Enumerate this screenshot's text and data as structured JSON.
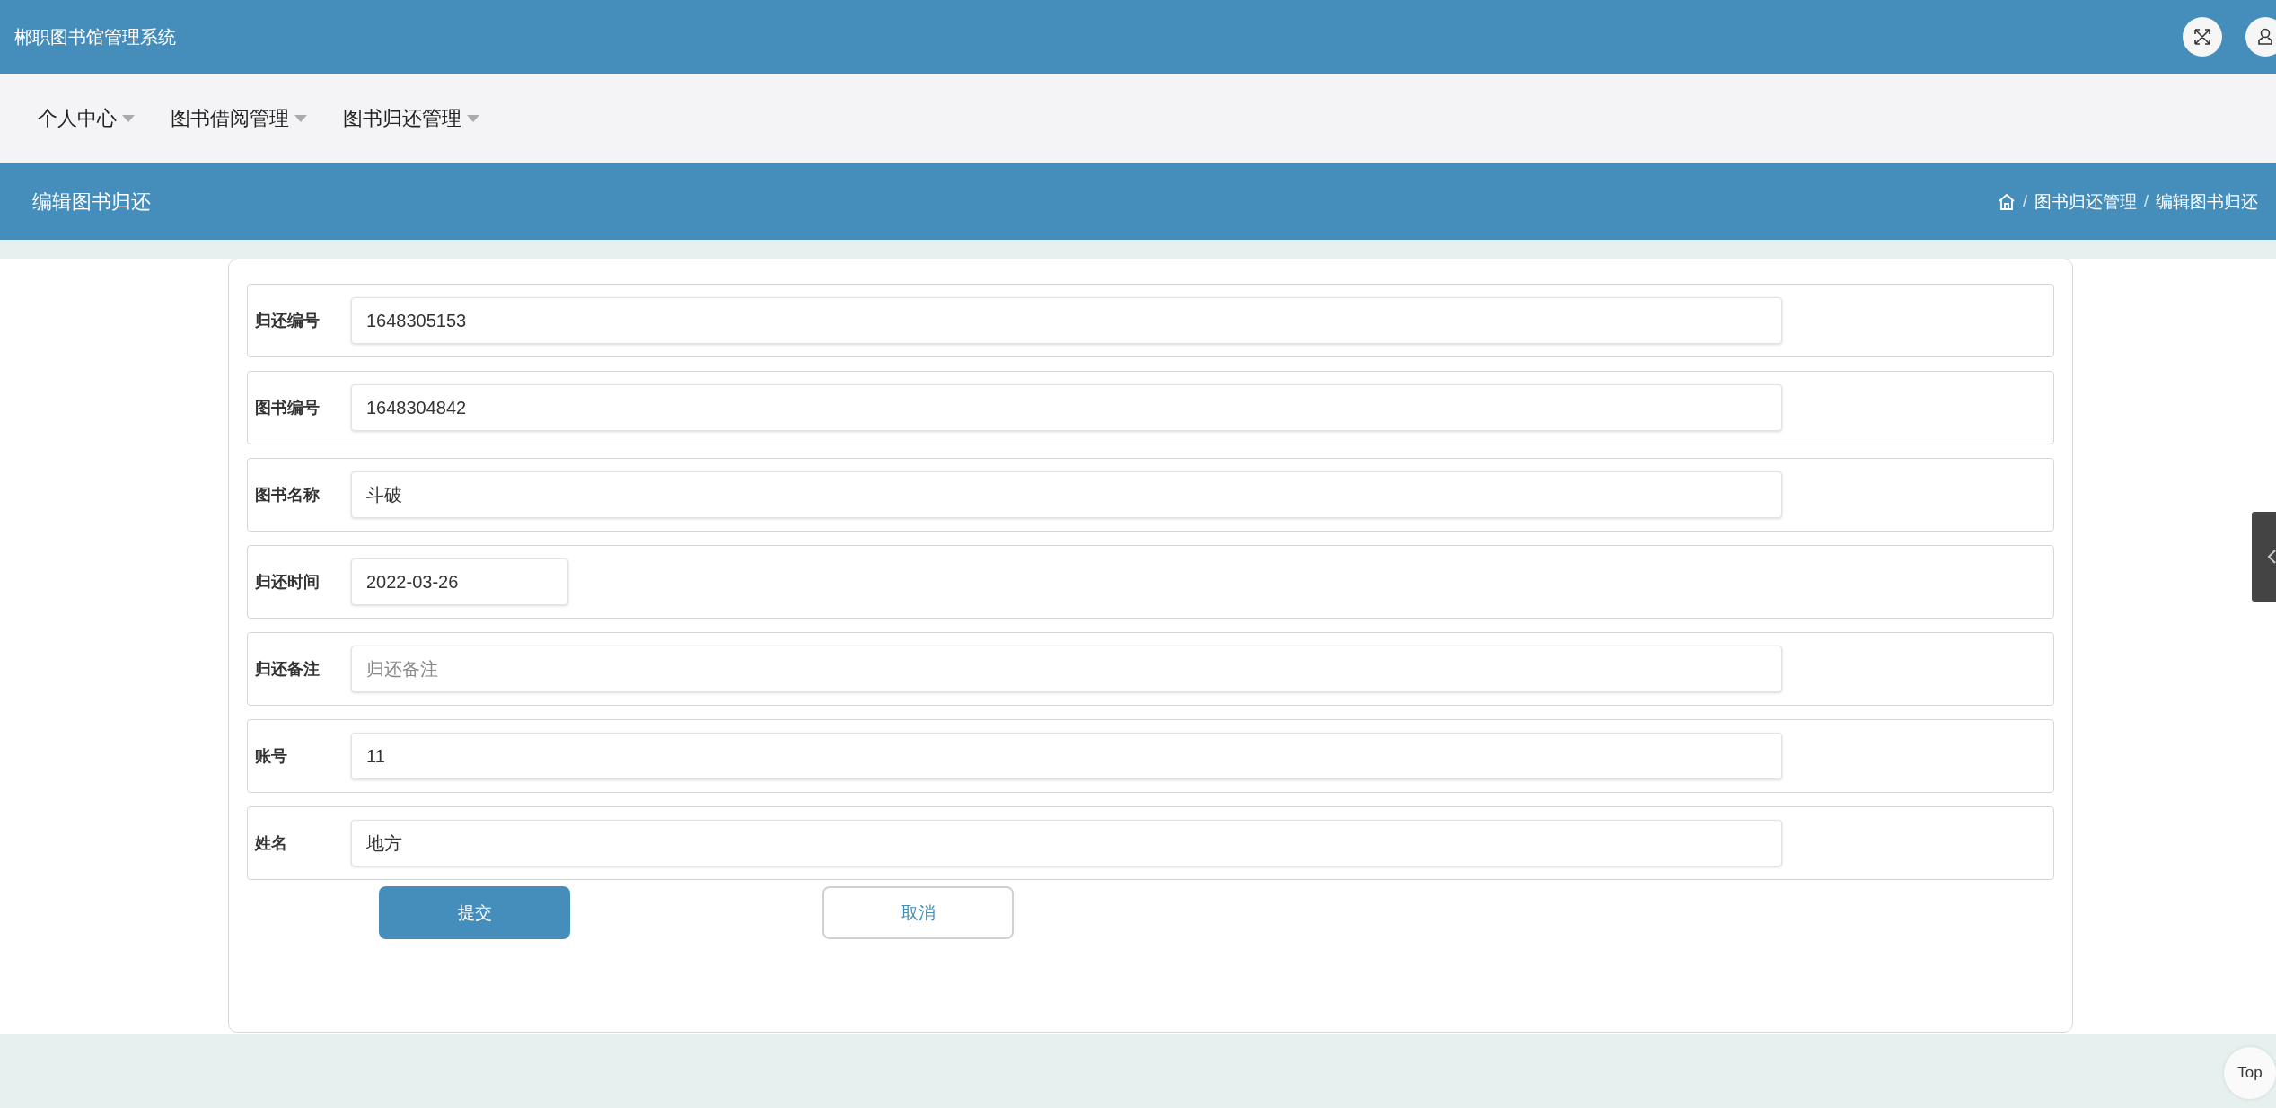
{
  "header": {
    "title": "郴职图书馆管理系统"
  },
  "nav": [
    {
      "label": "个人中心"
    },
    {
      "label": "图书借阅管理"
    },
    {
      "label": "图书归还管理"
    }
  ],
  "page_title": "编辑图书归还",
  "breadcrumb": [
    {
      "kind": "separator",
      "text": "/"
    },
    {
      "kind": "link",
      "text": "图书归还管理"
    },
    {
      "kind": "separator",
      "text": "/"
    },
    {
      "kind": "link",
      "text": "编辑图书归还"
    }
  ],
  "fields": [
    {
      "label": "归还编号",
      "kind": "text",
      "value": "1648305153"
    },
    {
      "label": "图书编号",
      "kind": "text",
      "value": "1648304842"
    },
    {
      "label": "图书名称",
      "kind": "text",
      "value": "斗破"
    },
    {
      "label": "归还时间",
      "kind": "date",
      "value": "2022-03-26"
    },
    {
      "label": "归还备注",
      "kind": "text",
      "placeholder": "归还备注"
    },
    {
      "label": "账号",
      "kind": "text",
      "value": "11"
    },
    {
      "label": "姓名",
      "kind": "text",
      "value": "地方"
    }
  ],
  "buttons": {
    "submit": "提交",
    "cancel": "取消"
  },
  "back_to_top": "Top"
}
